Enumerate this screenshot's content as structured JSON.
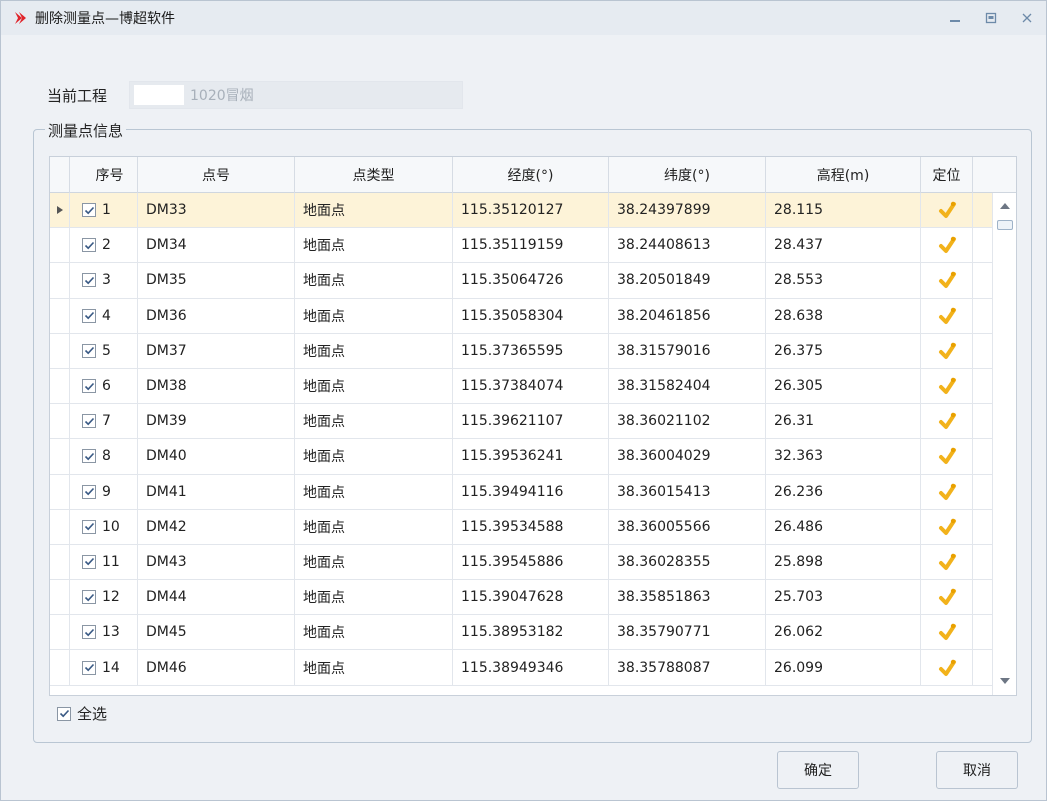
{
  "window": {
    "title": "删除测量点—博超软件",
    "controls": [
      "minimize",
      "maximize",
      "close"
    ]
  },
  "project": {
    "label": "当前工程",
    "value": "1020冒烟"
  },
  "group": {
    "legend": "测量点信息"
  },
  "grid": {
    "columns": [
      "序号",
      "点号",
      "点类型",
      "经度(°)",
      "纬度(°)",
      "高程(m)",
      "定位"
    ],
    "selected_row_index": 0,
    "rows": [
      {
        "seq": "1",
        "point": "DM33",
        "type": "地面点",
        "lon": "115.35120127",
        "lat": "38.24397899",
        "elev": "28.115",
        "checked": true
      },
      {
        "seq": "2",
        "point": "DM34",
        "type": "地面点",
        "lon": "115.35119159",
        "lat": "38.24408613",
        "elev": "28.437",
        "checked": true
      },
      {
        "seq": "3",
        "point": "DM35",
        "type": "地面点",
        "lon": "115.35064726",
        "lat": "38.20501849",
        "elev": "28.553",
        "checked": true
      },
      {
        "seq": "4",
        "point": "DM36",
        "type": "地面点",
        "lon": "115.35058304",
        "lat": "38.20461856",
        "elev": "28.638",
        "checked": true
      },
      {
        "seq": "5",
        "point": "DM37",
        "type": "地面点",
        "lon": "115.37365595",
        "lat": "38.31579016",
        "elev": "26.375",
        "checked": true
      },
      {
        "seq": "6",
        "point": "DM38",
        "type": "地面点",
        "lon": "115.37384074",
        "lat": "38.31582404",
        "elev": "26.305",
        "checked": true
      },
      {
        "seq": "7",
        "point": "DM39",
        "type": "地面点",
        "lon": "115.39621107",
        "lat": "38.36021102",
        "elev": "26.31",
        "checked": true
      },
      {
        "seq": "8",
        "point": "DM40",
        "type": "地面点",
        "lon": "115.39536241",
        "lat": "38.36004029",
        "elev": "32.363",
        "checked": true
      },
      {
        "seq": "9",
        "point": "DM41",
        "type": "地面点",
        "lon": "115.39494116",
        "lat": "38.36015413",
        "elev": "26.236",
        "checked": true
      },
      {
        "seq": "10",
        "point": "DM42",
        "type": "地面点",
        "lon": "115.39534588",
        "lat": "38.36005566",
        "elev": "26.486",
        "checked": true
      },
      {
        "seq": "11",
        "point": "DM43",
        "type": "地面点",
        "lon": "115.39545886",
        "lat": "38.36028355",
        "elev": "25.898",
        "checked": true
      },
      {
        "seq": "12",
        "point": "DM44",
        "type": "地面点",
        "lon": "115.39047628",
        "lat": "38.35851863",
        "elev": "25.703",
        "checked": true
      },
      {
        "seq": "13",
        "point": "DM45",
        "type": "地面点",
        "lon": "115.38953182",
        "lat": "38.35790771",
        "elev": "26.062",
        "checked": true
      },
      {
        "seq": "14",
        "point": "DM46",
        "type": "地面点",
        "lon": "115.38949346",
        "lat": "38.35788087",
        "elev": "26.099",
        "checked": true
      }
    ],
    "locate_icon": "pin-icon"
  },
  "select_all": {
    "label": "全选",
    "checked": true
  },
  "buttons": {
    "ok": "确定",
    "cancel": "取消"
  },
  "colors": {
    "title_icon": "#e0242b",
    "selected_row": "#fdf3d8",
    "locate_icon": "#f2b21b"
  }
}
